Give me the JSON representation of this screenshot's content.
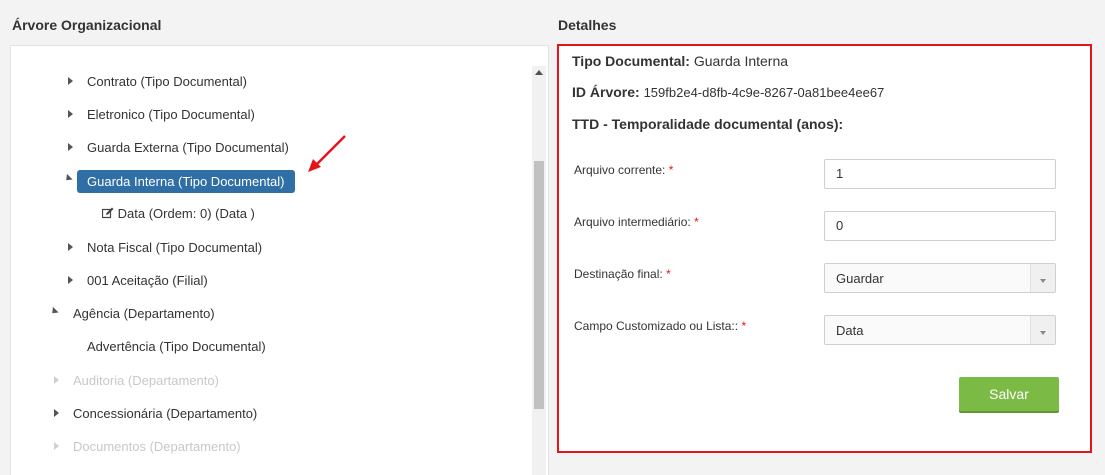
{
  "left": {
    "title": "Árvore Organizacional",
    "tree": [
      {
        "label": "Contrato (Tipo Documental)",
        "caret": "right",
        "disabled": false
      },
      {
        "label": "Eletronico (Tipo Documental)",
        "caret": "right",
        "disabled": false
      },
      {
        "label": "Guarda Externa (Tipo Documental)",
        "caret": "right",
        "disabled": false
      },
      {
        "label": "Guarda Interna (Tipo Documental)",
        "caret": "down",
        "selected": true
      },
      {
        "label": "Data (Ordem: 0) (Data )",
        "icon": "edit-icon"
      },
      {
        "label": "Nota Fiscal (Tipo Documental)",
        "caret": "right",
        "disabled": false
      },
      {
        "label": "001 Aceitação (Filial)",
        "caret": "right",
        "disabled": false
      },
      {
        "label": "Agência (Departamento)",
        "caret": "down",
        "disabled": false
      },
      {
        "label": "Advertência (Tipo Documental)",
        "disabled": false
      },
      {
        "label": "Auditoria (Departamento)",
        "caret": "right",
        "disabled": true
      },
      {
        "label": "Concessionária (Departamento)",
        "caret": "right",
        "disabled": false
      },
      {
        "label": "Documentos (Departamento)",
        "caret": "right",
        "disabled": true
      }
    ]
  },
  "right": {
    "title": "Detalhes",
    "tipo_documental_label": "Tipo Documental:",
    "tipo_documental_value": "Guarda Interna",
    "id_arvore_label": "ID Árvore:",
    "id_arvore_value": "159fb2e4-d8fb-4c9e-8267-0a81bee4ee67",
    "ttd_label": "TTD - Temporalidade documental (anos):",
    "required_mark": "*",
    "fields": {
      "arquivo_corrente": {
        "label": "Arquivo corrente:",
        "value": "1"
      },
      "arquivo_intermediario": {
        "label": "Arquivo intermediário:",
        "value": "0"
      },
      "destinacao_final": {
        "label": "Destinação final:",
        "value": "Guardar"
      },
      "campo_customizado": {
        "label": "Campo Customizado ou Lista::",
        "value": "Data"
      }
    },
    "save_label": "Salvar"
  },
  "colors": {
    "selected_node": "#2f6fa5",
    "highlight_border": "#e5141c",
    "save_button": "#7bbb45"
  }
}
